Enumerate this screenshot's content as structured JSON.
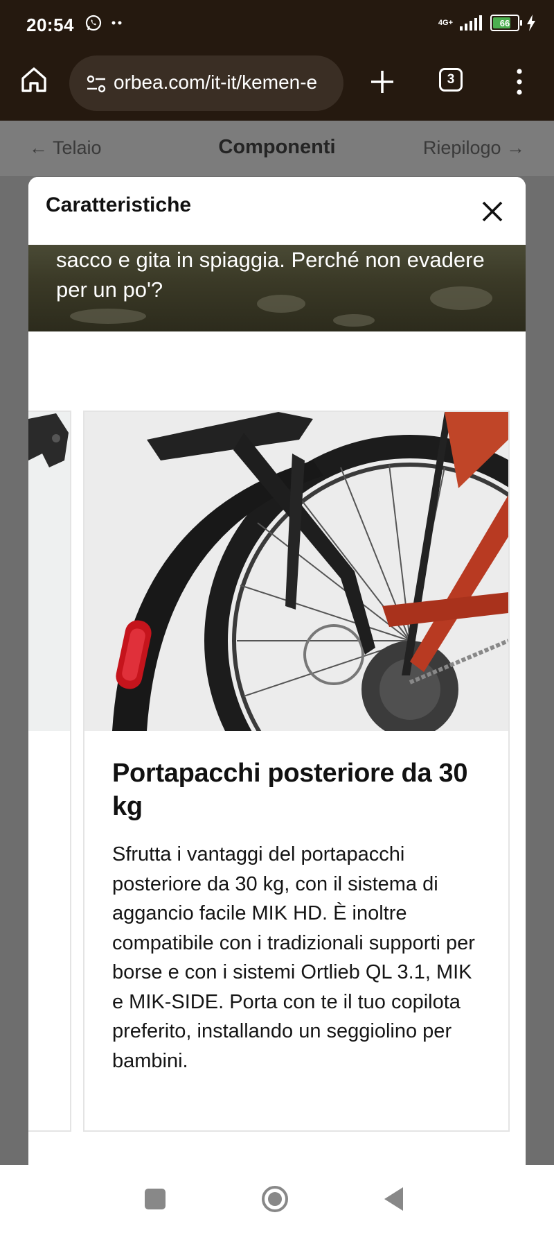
{
  "status_bar": {
    "time": "20:54",
    "network": "4G+",
    "battery_level": "66",
    "icons": [
      "whatsapp-icon",
      "more-dots-icon",
      "signal-icon",
      "battery-icon",
      "charging-icon"
    ]
  },
  "browser": {
    "url": "orbea.com/it-it/kemen-e",
    "tab_count": "3"
  },
  "steps": {
    "prev": "← Telaio",
    "current": "Componenti",
    "next": "Riepilogo →"
  },
  "modal": {
    "title": "Caratteristiche",
    "hero_text": "sacco e gita in spiaggia. Perché non evadere per un po'?",
    "card": {
      "title": "Portapacchi posteriore da 30 kg",
      "description": "Sfrutta i vantaggi del portapacchi posteriore da 30 kg, con il sistema di aggancio facile MIK HD. È inoltre compatibile con i tradizionali supporti per borse e con i sistemi Ortlieb QL 3.1, MIK e MIK-SIDE. Porta con te il tuo copilota preferito, installando un seggiolino per bambini."
    }
  },
  "colors": {
    "browser_chrome": "#25190f",
    "url_box": "#3a2e24",
    "overlay": "#6e6e6e",
    "frame_red": "#b83a22"
  }
}
